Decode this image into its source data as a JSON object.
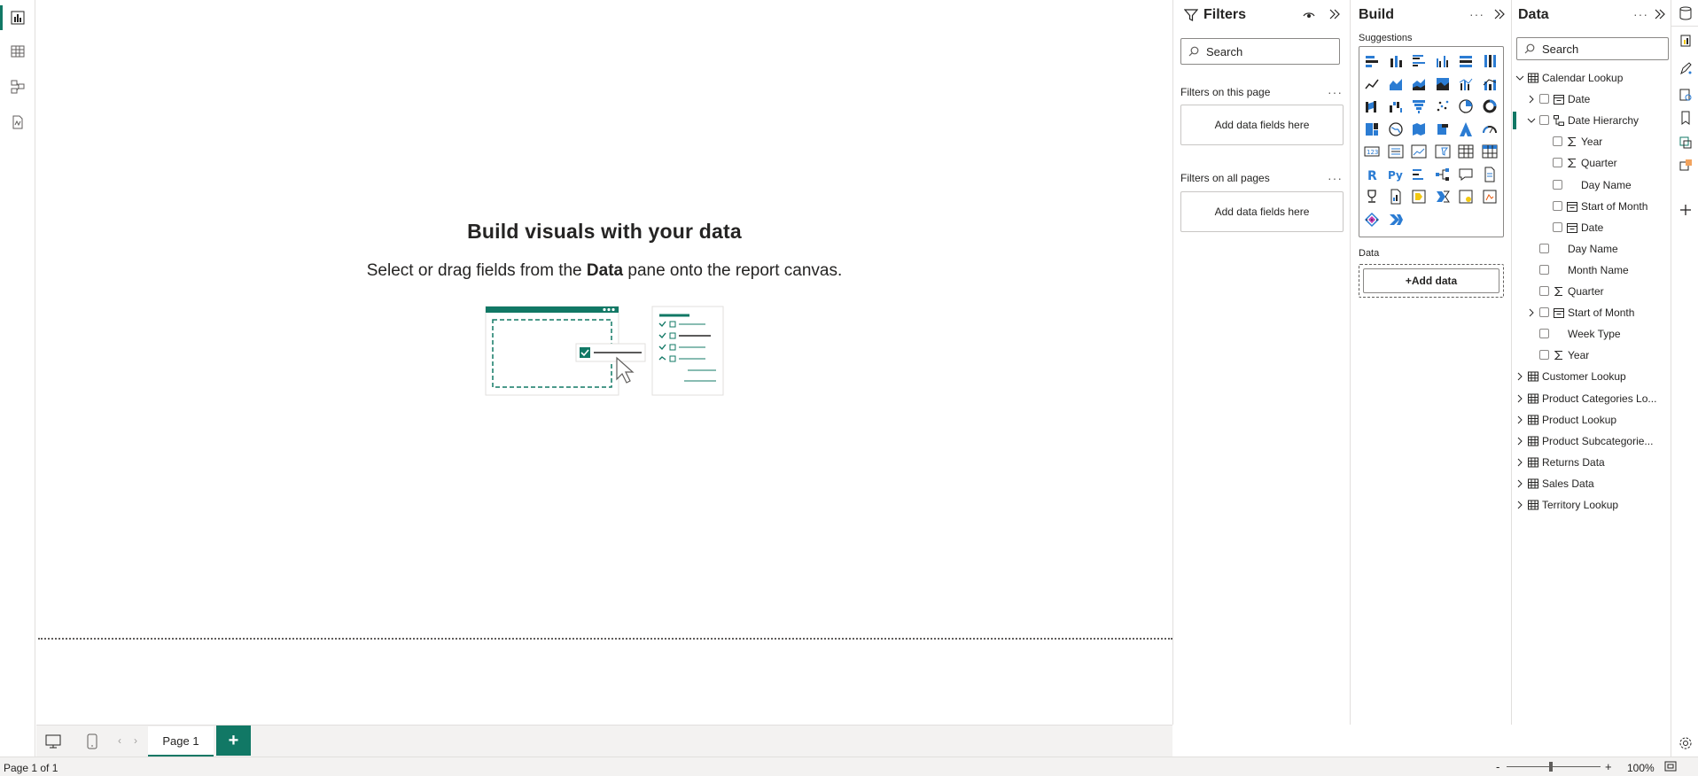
{
  "canvas": {
    "title": "Build visuals with your data",
    "subtitle_pre": "Select or drag fields from the ",
    "subtitle_bold": "Data",
    "subtitle_post": " pane onto the report canvas."
  },
  "tabs": {
    "page_label": "Page 1",
    "add_label": "+"
  },
  "status": {
    "page_info": "Page 1 of 1",
    "zoom": "100%",
    "zoom_minus": "-",
    "zoom_plus": "+"
  },
  "filters": {
    "title": "Filters",
    "search_placeholder": "Search",
    "on_this_page": "Filters on this page",
    "on_all_pages": "Filters on all pages",
    "drop_label": "Add data fields here"
  },
  "build": {
    "title": "Build",
    "suggestions": "Suggestions",
    "data_label": "Data",
    "add_data": "+Add data",
    "more": "···"
  },
  "data_pane": {
    "title": "Data",
    "search_placeholder": "Search",
    "tree": [
      {
        "label": "Calendar Lookup",
        "level": 0,
        "icon": "table-icon",
        "expand": "open",
        "cb": false
      },
      {
        "label": "Date",
        "level": 1,
        "icon": "calendar-icon",
        "expand": "closed",
        "cb": true
      },
      {
        "label": "Date Hierarchy",
        "level": 1,
        "icon": "hierarchy-icon",
        "expand": "open",
        "cb": true,
        "selected": true
      },
      {
        "label": "Year",
        "level": 2,
        "icon": "sigma-icon",
        "expand": "none",
        "cb": true
      },
      {
        "label": "Quarter",
        "level": 2,
        "icon": "sigma-icon",
        "expand": "none",
        "cb": true
      },
      {
        "label": "Day Name",
        "level": 2,
        "icon": "none",
        "expand": "none",
        "cb": true
      },
      {
        "label": "Start of Month",
        "level": 2,
        "icon": "calendar-icon",
        "expand": "none",
        "cb": true
      },
      {
        "label": "Date",
        "level": 2,
        "icon": "calendar-icon",
        "expand": "none",
        "cb": true
      },
      {
        "label": "Day Name",
        "level": 1,
        "icon": "none",
        "expand": "none",
        "cb": true
      },
      {
        "label": "Month Name",
        "level": 1,
        "icon": "none",
        "expand": "none",
        "cb": true
      },
      {
        "label": "Quarter",
        "level": 1,
        "icon": "sigma-icon",
        "expand": "none",
        "cb": true
      },
      {
        "label": "Start of Month",
        "level": 1,
        "icon": "calendar-icon",
        "expand": "closed",
        "cb": true
      },
      {
        "label": "Week Type",
        "level": 1,
        "icon": "none",
        "expand": "none",
        "cb": true
      },
      {
        "label": "Year",
        "level": 1,
        "icon": "sigma-icon",
        "expand": "none",
        "cb": true
      },
      {
        "label": "Customer Lookup",
        "level": 0,
        "icon": "table-icon",
        "expand": "closed",
        "cb": false
      },
      {
        "label": "Product Categories Lo...",
        "level": 0,
        "icon": "table-icon",
        "expand": "closed",
        "cb": false
      },
      {
        "label": "Product Lookup",
        "level": 0,
        "icon": "table-icon",
        "expand": "closed",
        "cb": false
      },
      {
        "label": "Product Subcategorie...",
        "level": 0,
        "icon": "table-icon",
        "expand": "closed",
        "cb": false
      },
      {
        "label": "Returns Data",
        "level": 0,
        "icon": "table-icon",
        "expand": "closed",
        "cb": false
      },
      {
        "label": "Sales Data",
        "level": 0,
        "icon": "table-icon",
        "expand": "closed",
        "cb": false
      },
      {
        "label": "Territory Lookup",
        "level": 0,
        "icon": "table-icon",
        "expand": "closed",
        "cb": false
      }
    ]
  },
  "colors": {
    "accent": "#117865",
    "viz_blue": "#2b7cd3"
  }
}
